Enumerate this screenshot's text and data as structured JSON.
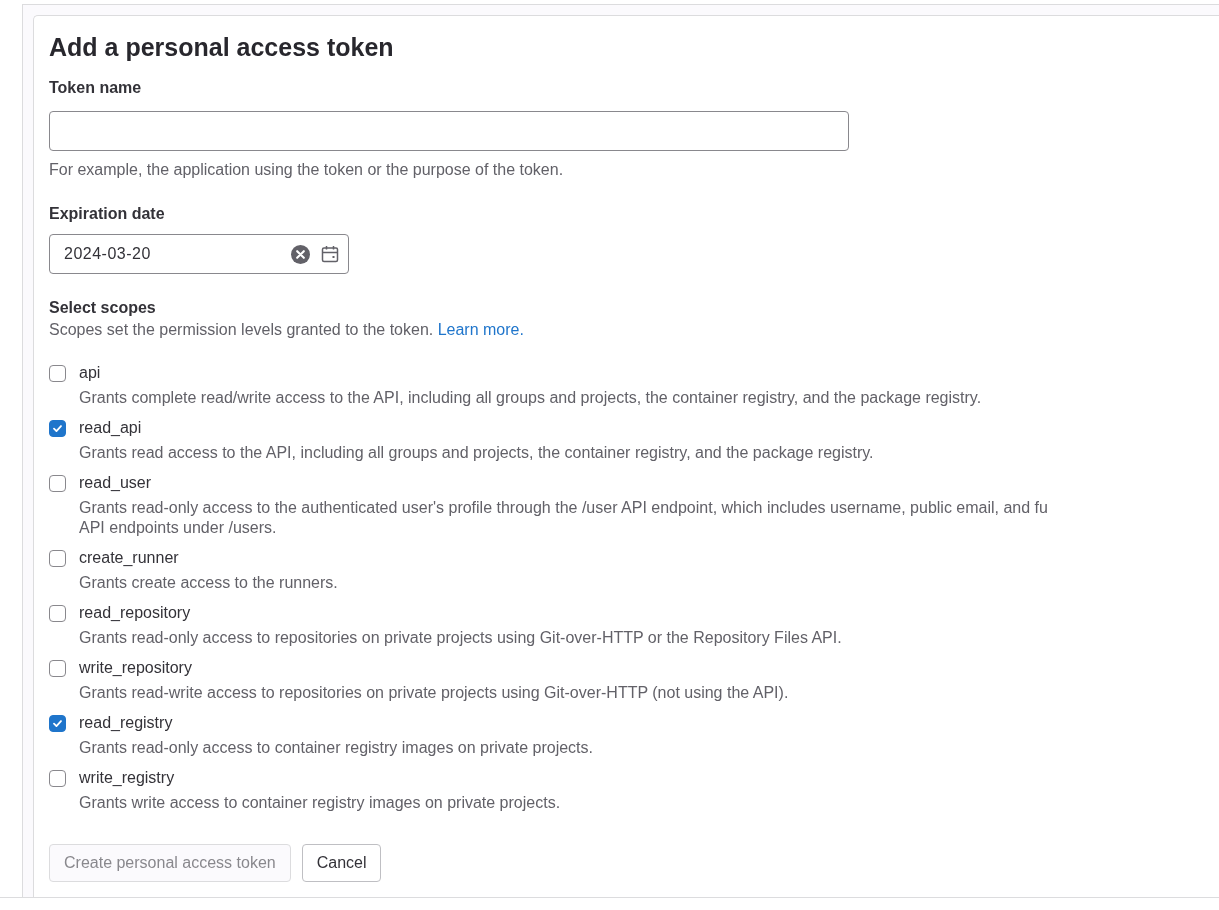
{
  "title": "Add a personal access token",
  "token_name": {
    "label": "Token name",
    "hint": "For example, the application using the token or the purpose of the token."
  },
  "expiration_date": {
    "label": "Expiration date",
    "value": "2024-03-20"
  },
  "scopes": {
    "label": "Select scopes",
    "description": "Scopes set the permission levels granted to the token.",
    "link": "Learn more.",
    "items": [
      {
        "name": "api",
        "checked": false,
        "description": [
          "Grants complete read/write access to the API, including all groups and projects, the container registry, and the package registry."
        ]
      },
      {
        "name": "read_api",
        "checked": true,
        "description": [
          "Grants read access to the API, including all groups and projects, the container registry, and the package registry."
        ]
      },
      {
        "name": "read_user",
        "checked": false,
        "description": [
          "Grants read-only access to the authenticated user's profile through the /user API endpoint, which includes username, public email, and fu",
          "API endpoints under /users."
        ]
      },
      {
        "name": "create_runner",
        "checked": false,
        "description": [
          "Grants create access to the runners."
        ]
      },
      {
        "name": "read_repository",
        "checked": false,
        "description": [
          "Grants read-only access to repositories on private projects using Git-over-HTTP or the Repository Files API."
        ]
      },
      {
        "name": "write_repository",
        "checked": false,
        "description": [
          "Grants read-write access to repositories on private projects using Git-over-HTTP (not using the API)."
        ]
      },
      {
        "name": "read_registry",
        "checked": true,
        "description": [
          "Grants read-only access to container registry images on private projects."
        ]
      },
      {
        "name": "write_registry",
        "checked": false,
        "description": [
          "Grants write access to container registry images on private projects."
        ]
      }
    ]
  },
  "buttons": [
    {
      "label": "Create personal access token",
      "disabled": true
    },
    {
      "label": "Cancel",
      "disabled": false
    }
  ]
}
